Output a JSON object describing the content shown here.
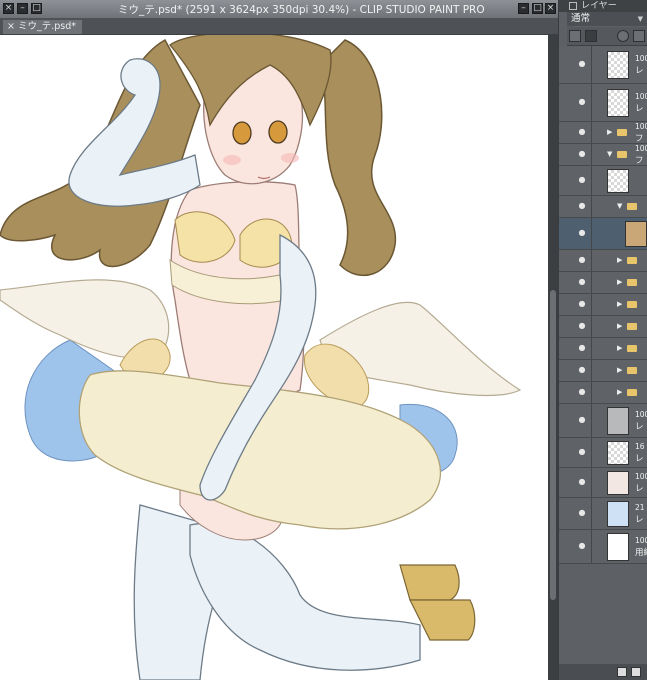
{
  "titlebar": {
    "title": "ミウ_テ.psd* (2591 x 3624px 350dpi 30.4%) - CLIP STUDIO PAINT PRO"
  },
  "document_tab": {
    "label": "ミウ_テ.psd*",
    "close_glyph": "×"
  },
  "layer_panel": {
    "header_title": "レイヤー",
    "blend_mode": "通常",
    "layers": [
      {
        "opacity": "100",
        "name": "レ",
        "kind": "raster",
        "thumb": "checker"
      },
      {
        "opacity": "100",
        "name": "レ",
        "kind": "raster",
        "thumb": "checker"
      },
      {
        "opacity": "100",
        "name": "フ",
        "kind": "folder",
        "expanded": false
      },
      {
        "opacity": "100",
        "name": "フ",
        "kind": "folder",
        "expanded": true
      },
      {
        "opacity": "",
        "name": "",
        "kind": "raster",
        "thumb": "checker"
      },
      {
        "opacity": "",
        "name": "",
        "kind": "subfolder",
        "expanded": true
      },
      {
        "opacity": "",
        "name": "",
        "kind": "raster",
        "thumb": "figure",
        "selected": true
      },
      {
        "opacity": "",
        "name": "",
        "kind": "subfolder",
        "expanded": false
      },
      {
        "opacity": "",
        "name": "",
        "kind": "subfolder",
        "expanded": false
      },
      {
        "opacity": "",
        "name": "",
        "kind": "subfolder",
        "expanded": false
      },
      {
        "opacity": "",
        "name": "",
        "kind": "subfolder",
        "expanded": false
      },
      {
        "opacity": "",
        "name": "",
        "kind": "subfolder",
        "expanded": false
      },
      {
        "opacity": "",
        "name": "",
        "kind": "subfolder",
        "expanded": false
      },
      {
        "opacity": "",
        "name": "",
        "kind": "subfolder",
        "expanded": false
      },
      {
        "opacity": "100",
        "name": "レ",
        "kind": "raster",
        "thumb": "gray"
      },
      {
        "opacity": "16",
        "name": "レ",
        "kind": "raster",
        "thumb": "checker"
      },
      {
        "opacity": "100",
        "name": "レ",
        "kind": "raster",
        "thumb": "sketch"
      },
      {
        "opacity": "21",
        "name": "レ",
        "kind": "raster",
        "thumb": "blue"
      },
      {
        "opacity": "100",
        "name": "用紙",
        "kind": "paper",
        "thumb": "white"
      }
    ]
  },
  "icons": {
    "eye": "eye-icon",
    "folder": "folder-icon"
  },
  "colors": {
    "hair": "#a88f5c",
    "skin": "#fbe6df",
    "gloves": "#eaf2f8",
    "cream": "#f5edcf",
    "blue_petticoat": "#9fc4ec",
    "gold": "#d9b96a"
  }
}
